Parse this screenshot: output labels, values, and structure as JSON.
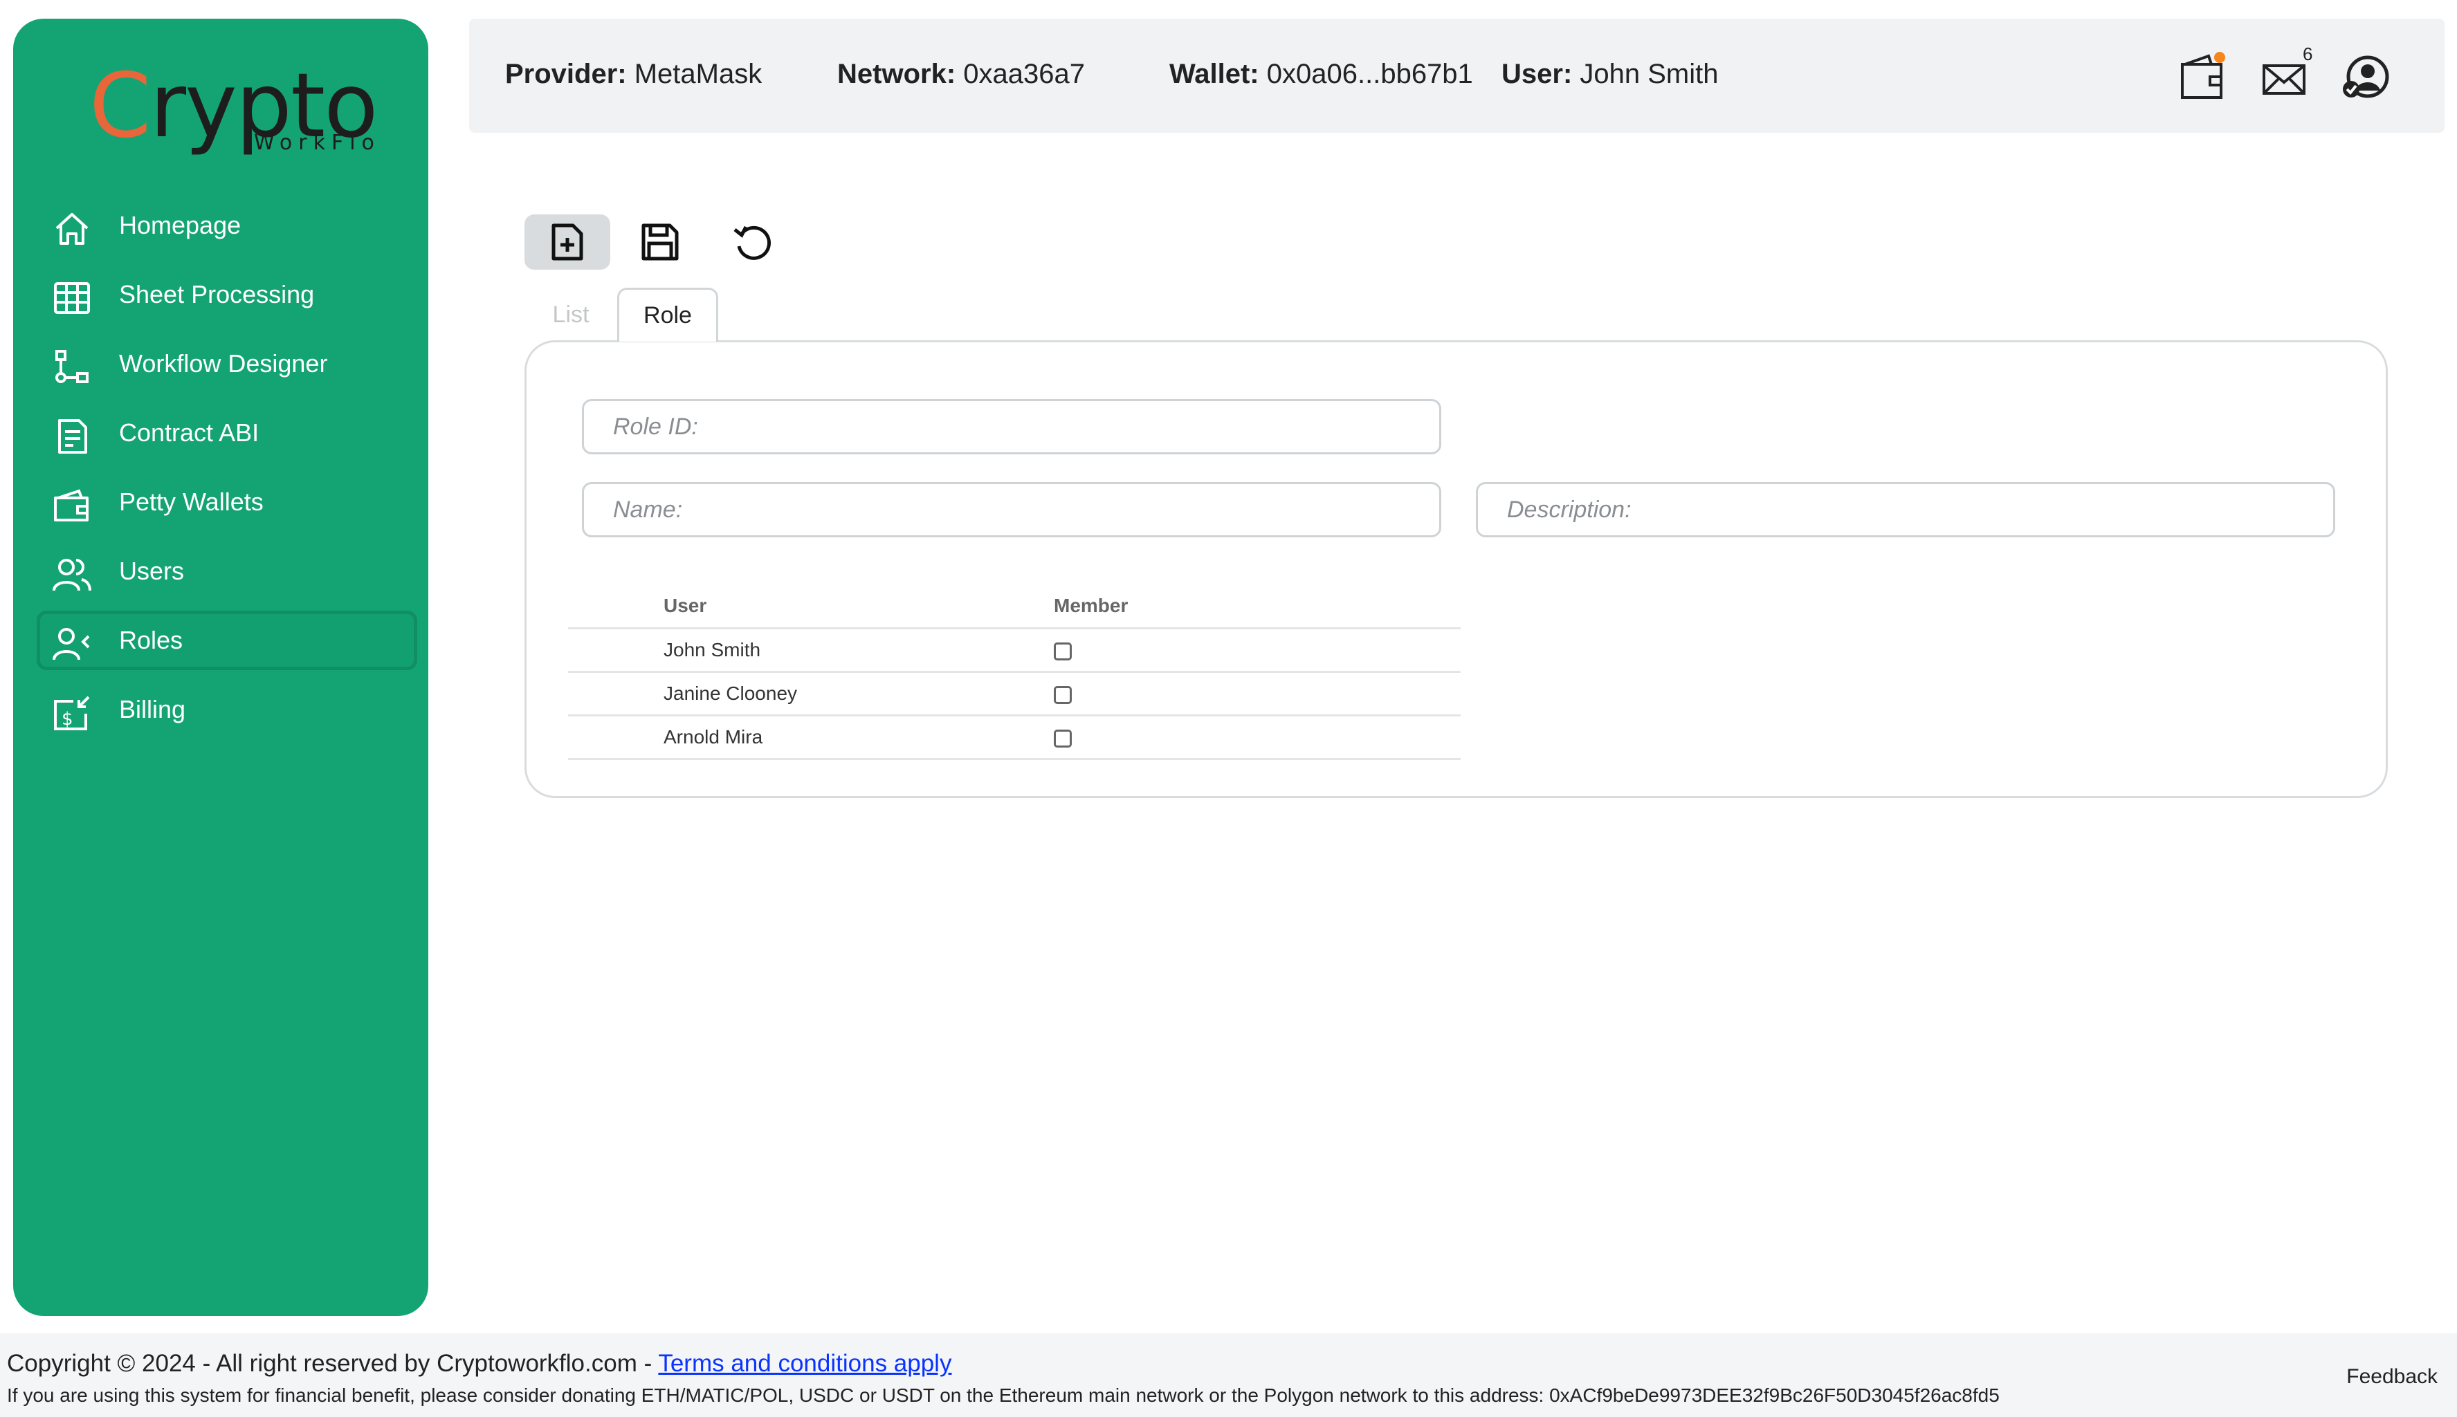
{
  "brand": {
    "logo_main": "rypto",
    "logo_c": "C",
    "logo_sub": "WorkFlo"
  },
  "sidebar": {
    "items": [
      {
        "label": "Homepage",
        "icon": "home-icon"
      },
      {
        "label": "Sheet Processing",
        "icon": "table-icon"
      },
      {
        "label": "Workflow Designer",
        "icon": "workflow-icon"
      },
      {
        "label": "Contract ABI",
        "icon": "document-icon"
      },
      {
        "label": "Petty Wallets",
        "icon": "wallet-icon"
      },
      {
        "label": "Users",
        "icon": "users-icon"
      },
      {
        "label": "Roles",
        "icon": "roles-icon",
        "active": true
      },
      {
        "label": "Billing",
        "icon": "billing-icon"
      }
    ]
  },
  "header": {
    "provider_label": "Provider:",
    "provider_value": " MetaMask",
    "network_label": "Network:",
    "network_value": " 0xaa36a7",
    "wallet_label": "Wallet:",
    "wallet_value": " 0x0a06...bb67b1",
    "user_label": "User:",
    "user_value": " John Smith",
    "mail_count": "6"
  },
  "toolbar": {
    "buttons": [
      "new-document",
      "save",
      "refresh"
    ]
  },
  "tabs": [
    {
      "label": "List",
      "active": false
    },
    {
      "label": "Role",
      "active": true
    }
  ],
  "form": {
    "role_id_placeholder": "Role ID:",
    "name_placeholder": "Name:",
    "description_placeholder": "Description:"
  },
  "members_table": {
    "columns": [
      "User",
      "Member"
    ],
    "rows": [
      {
        "user": "John Smith",
        "member": false
      },
      {
        "user": "Janine Clooney",
        "member": false
      },
      {
        "user": "Arnold Mira",
        "member": false
      }
    ]
  },
  "footer": {
    "copyright": "Copyright © 2024 - All right reserved by Cryptoworkflo.com - ",
    "terms_link": "Terms and conditions apply",
    "donation": "If you are using this system for financial benefit, please consider donating ETH/MATIC/POL, USDC or USDT on the Ethereum main network or the Polygon network to this address: 0xACf9beDe9973DEE32f9Bc26F50D3045f26ac8fd5",
    "feedback": "Feedback"
  },
  "colors": {
    "sidebar_bg": "#14a473",
    "logo_accent": "#e8663a",
    "link": "#0b33ff"
  }
}
